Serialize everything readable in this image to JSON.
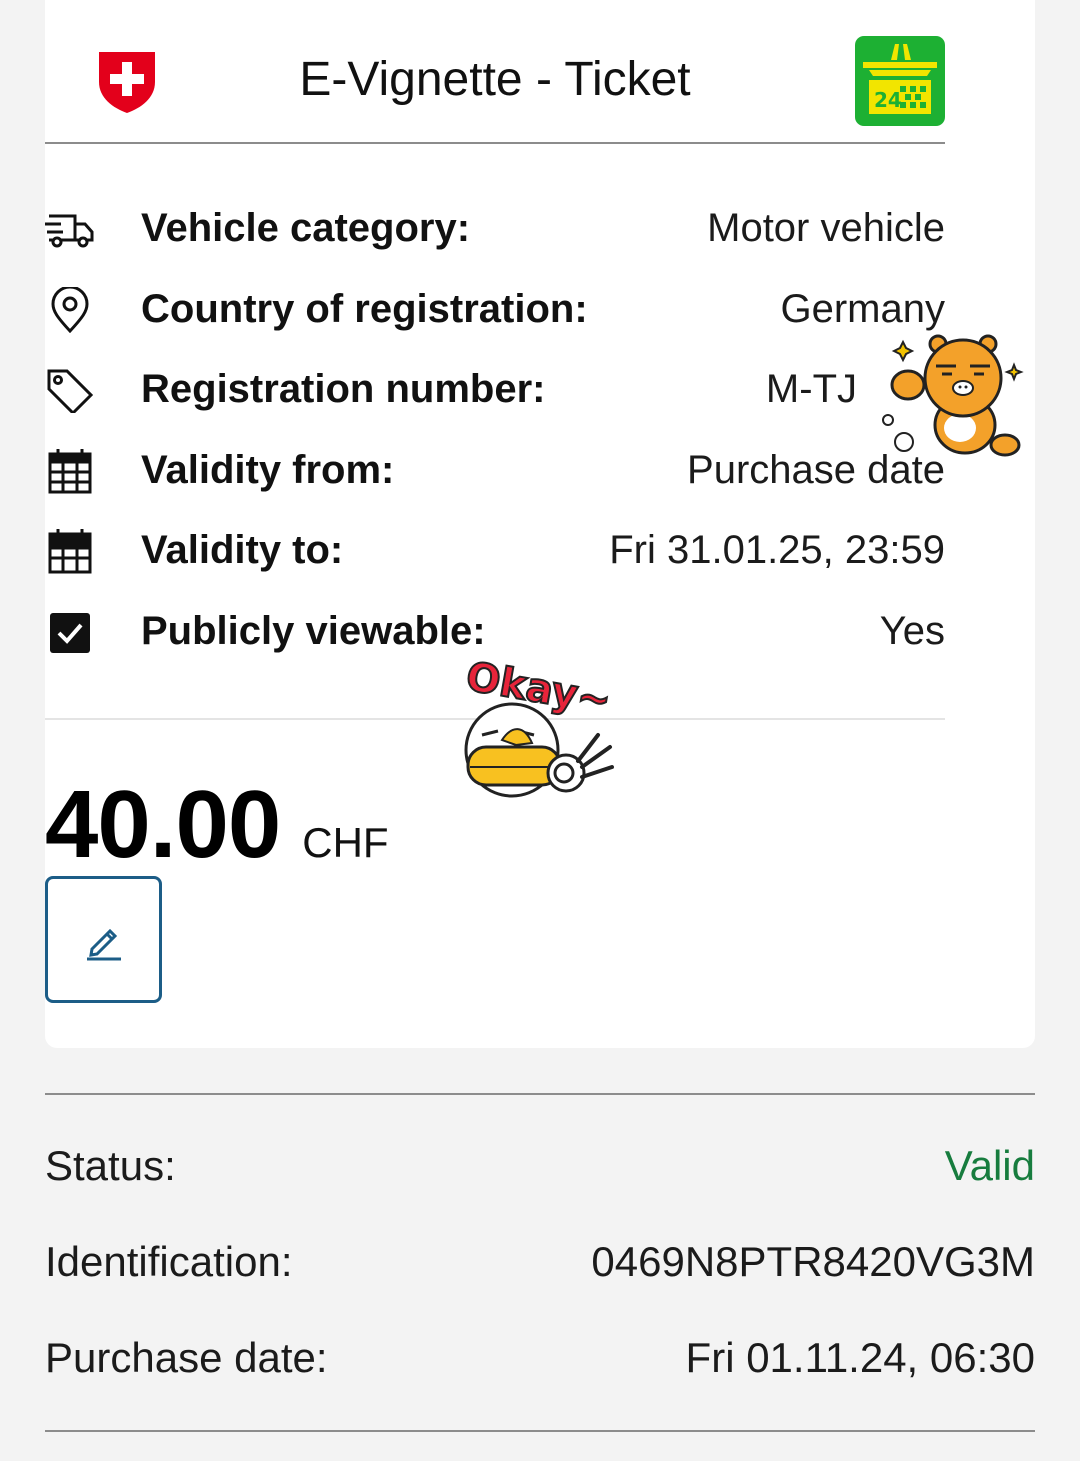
{
  "header": {
    "title": "E-Vignette - Ticket",
    "logo_text": "24"
  },
  "details": [
    {
      "icon": "truck-icon",
      "label": "Vehicle category:",
      "value": "Motor vehicle"
    },
    {
      "icon": "location-pin-icon",
      "label": "Country of registration:",
      "value": "Germany"
    },
    {
      "icon": "tag-icon",
      "label": "Registration number:",
      "value": "M-TJ"
    },
    {
      "icon": "calendar-icon",
      "label": "Validity from:",
      "value": "Purchase date"
    },
    {
      "icon": "calendar-filled-icon",
      "label": "Validity to:",
      "value": "Fri 31.01.25, 23:59"
    },
    {
      "icon": "checkbox-checked-icon",
      "label": "Publicly viewable:",
      "value": "Yes"
    }
  ],
  "price": {
    "amount": "40.00",
    "currency": "CHF"
  },
  "stickers": {
    "okay_text": "Okay~"
  },
  "info": {
    "status_label": "Status:",
    "status_value": "Valid",
    "identification_label": "Identification:",
    "identification_value": "0469N8PTR8420VG3M",
    "purchase_date_label": "Purchase date:",
    "purchase_date_value": "Fri 01.11.24, 06:30"
  },
  "colors": {
    "swiss_red": "#e3001b",
    "logo_green": "#1db033",
    "status_valid": "#177c3e",
    "edit_border": "#1c5d87"
  }
}
